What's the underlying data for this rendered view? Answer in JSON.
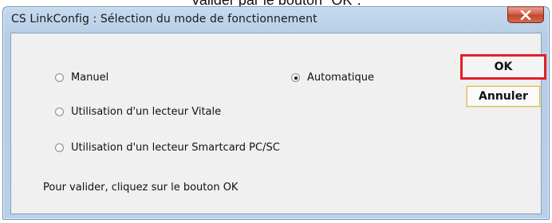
{
  "top_caption": "Valider par le bouton \"OK\".",
  "window": {
    "title": "CS LinkConfig : Sélection du mode de fonctionnement",
    "close_icon": "close-icon"
  },
  "options": [
    {
      "label": "Manuel",
      "checked": false
    },
    {
      "label": "Automatique",
      "checked": true
    },
    {
      "label": "Utilisation d'un lecteur Vitale",
      "checked": false
    },
    {
      "label": "Utilisation d'un lecteur Smartcard PC/SC",
      "checked": false
    }
  ],
  "buttons": {
    "ok_label": "OK",
    "cancel_label": "Annuler"
  },
  "hint": "Pour valider, cliquez sur le bouton OK",
  "colors": {
    "highlight_border": "#e41e26",
    "close_button": "#c1432b",
    "window_frame": "#b9d0e8"
  }
}
